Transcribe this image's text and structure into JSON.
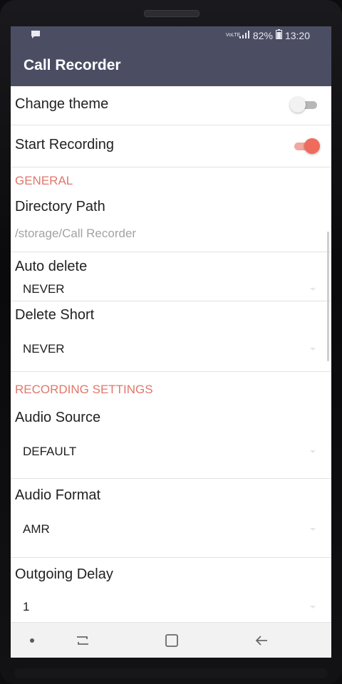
{
  "status_bar": {
    "signal_label": "VoLTE",
    "battery_percent": "82%",
    "time": "13:20",
    "icons": [
      "message-icon",
      "volte-icon",
      "signal-icon",
      "battery-icon"
    ]
  },
  "app_bar": {
    "title": "Call Recorder"
  },
  "settings": {
    "change_theme": {
      "label": "Change theme",
      "enabled": false
    },
    "start_recording": {
      "label": "Start Recording",
      "enabled": true
    },
    "general_header": "GENERAL",
    "directory_path": {
      "label": "Directory Path",
      "value": "/storage/Call Recorder"
    },
    "auto_delete": {
      "label": "Auto delete",
      "value": "NEVER"
    },
    "delete_short": {
      "label": "Delete Short",
      "value": "NEVER"
    },
    "recording_header": "RECORDING SETTINGS",
    "audio_source": {
      "label": "Audio Source",
      "value": "DEFAULT"
    },
    "audio_format": {
      "label": "Audio Format",
      "value": "AMR"
    },
    "outgoing_delay": {
      "label": "Outgoing Delay",
      "value": "1"
    }
  },
  "colors": {
    "app_bar": "#4b4e63",
    "accent": "#ef6b5c",
    "section_header": "#e0776b"
  },
  "nav_bar": {
    "icons": [
      "dot-icon",
      "recent-apps-icon",
      "home-icon",
      "back-icon"
    ]
  }
}
